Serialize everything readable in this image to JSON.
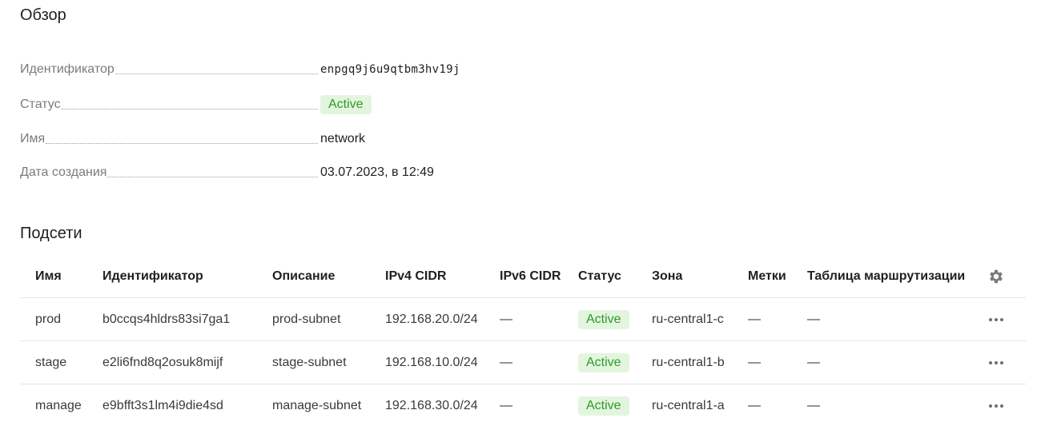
{
  "overview": {
    "title": "Обзор",
    "fields": {
      "id_label": "Идентификатор",
      "id_value": "enpgq9j6u9qtbm3hv19j",
      "status_label": "Статус",
      "status_value": "Active",
      "name_label": "Имя",
      "name_value": "network",
      "created_label": "Дата создания",
      "created_value": "03.07.2023, в 12:49"
    }
  },
  "subnets": {
    "title": "Подсети",
    "columns": {
      "name": "Имя",
      "id": "Идентификатор",
      "description": "Описание",
      "ipv4": "IPv4 CIDR",
      "ipv6": "IPv6 CIDR",
      "status": "Статус",
      "zone": "Зона",
      "labels": "Метки",
      "route_table": "Таблица маршрутизации"
    },
    "settings_icon": "gear-icon",
    "rows": [
      {
        "name": "prod",
        "id": "b0ccqs4hldrs83si7ga1",
        "description": "prod-subnet",
        "ipv4": "192.168.20.0/24",
        "ipv6": "—",
        "status": "Active",
        "zone": "ru-central1-c",
        "labels": "—",
        "route_table": "—"
      },
      {
        "name": "stage",
        "id": "e2li6fnd8q2osuk8mijf",
        "description": "stage-subnet",
        "ipv4": "192.168.10.0/24",
        "ipv6": "—",
        "status": "Active",
        "zone": "ru-central1-b",
        "labels": "—",
        "route_table": "—"
      },
      {
        "name": "manage",
        "id": "e9bfft3s1lm4i9die4sd",
        "description": "manage-subnet",
        "ipv4": "192.168.30.0/24",
        "ipv6": "—",
        "status": "Active",
        "zone": "ru-central1-a",
        "labels": "—",
        "route_table": "—"
      }
    ],
    "row_actions_icon": "more-horizontal-icon"
  },
  "colors": {
    "status_active_text": "#2e9b25",
    "status_active_bg": "#e3f5df"
  }
}
